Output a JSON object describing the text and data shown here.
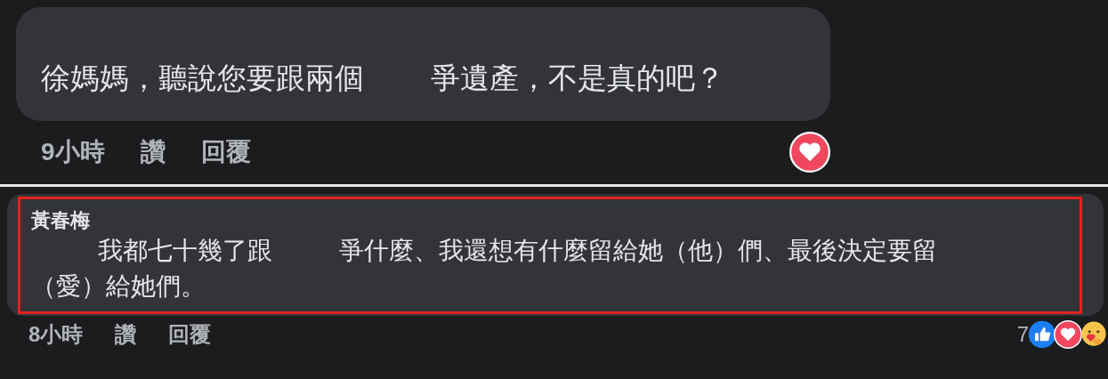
{
  "comments": [
    {
      "lines": [
        [
          {
            "kind": "text",
            "text": "徐媽媽，聽說您要跟兩個"
          },
          {
            "kind": "redacted"
          },
          {
            "kind": "text",
            "text": "爭遺產，不是真的吧？"
          }
        ]
      ],
      "time": "9小時",
      "like_label": "讚",
      "reply_label": "回覆",
      "highlighted": false,
      "reactions": [
        {
          "kind": "love"
        }
      ]
    },
    {
      "author": "黃春梅",
      "lines": [
        [
          {
            "kind": "redacted"
          },
          {
            "kind": "text",
            "text": "我都七十幾了跟"
          },
          {
            "kind": "redacted"
          },
          {
            "kind": "text",
            "text": "爭什麼、我還想有什麼留給她（他）們、最後決定要留"
          }
        ],
        [
          {
            "kind": "text",
            "text": "（愛）給她們。"
          }
        ]
      ],
      "time": "8小時",
      "like_label": "讚",
      "reply_label": "回覆",
      "highlighted": true,
      "reaction_count": "7",
      "reactions": [
        {
          "kind": "like"
        },
        {
          "kind": "love"
        },
        {
          "kind": "care"
        }
      ]
    }
  ]
}
